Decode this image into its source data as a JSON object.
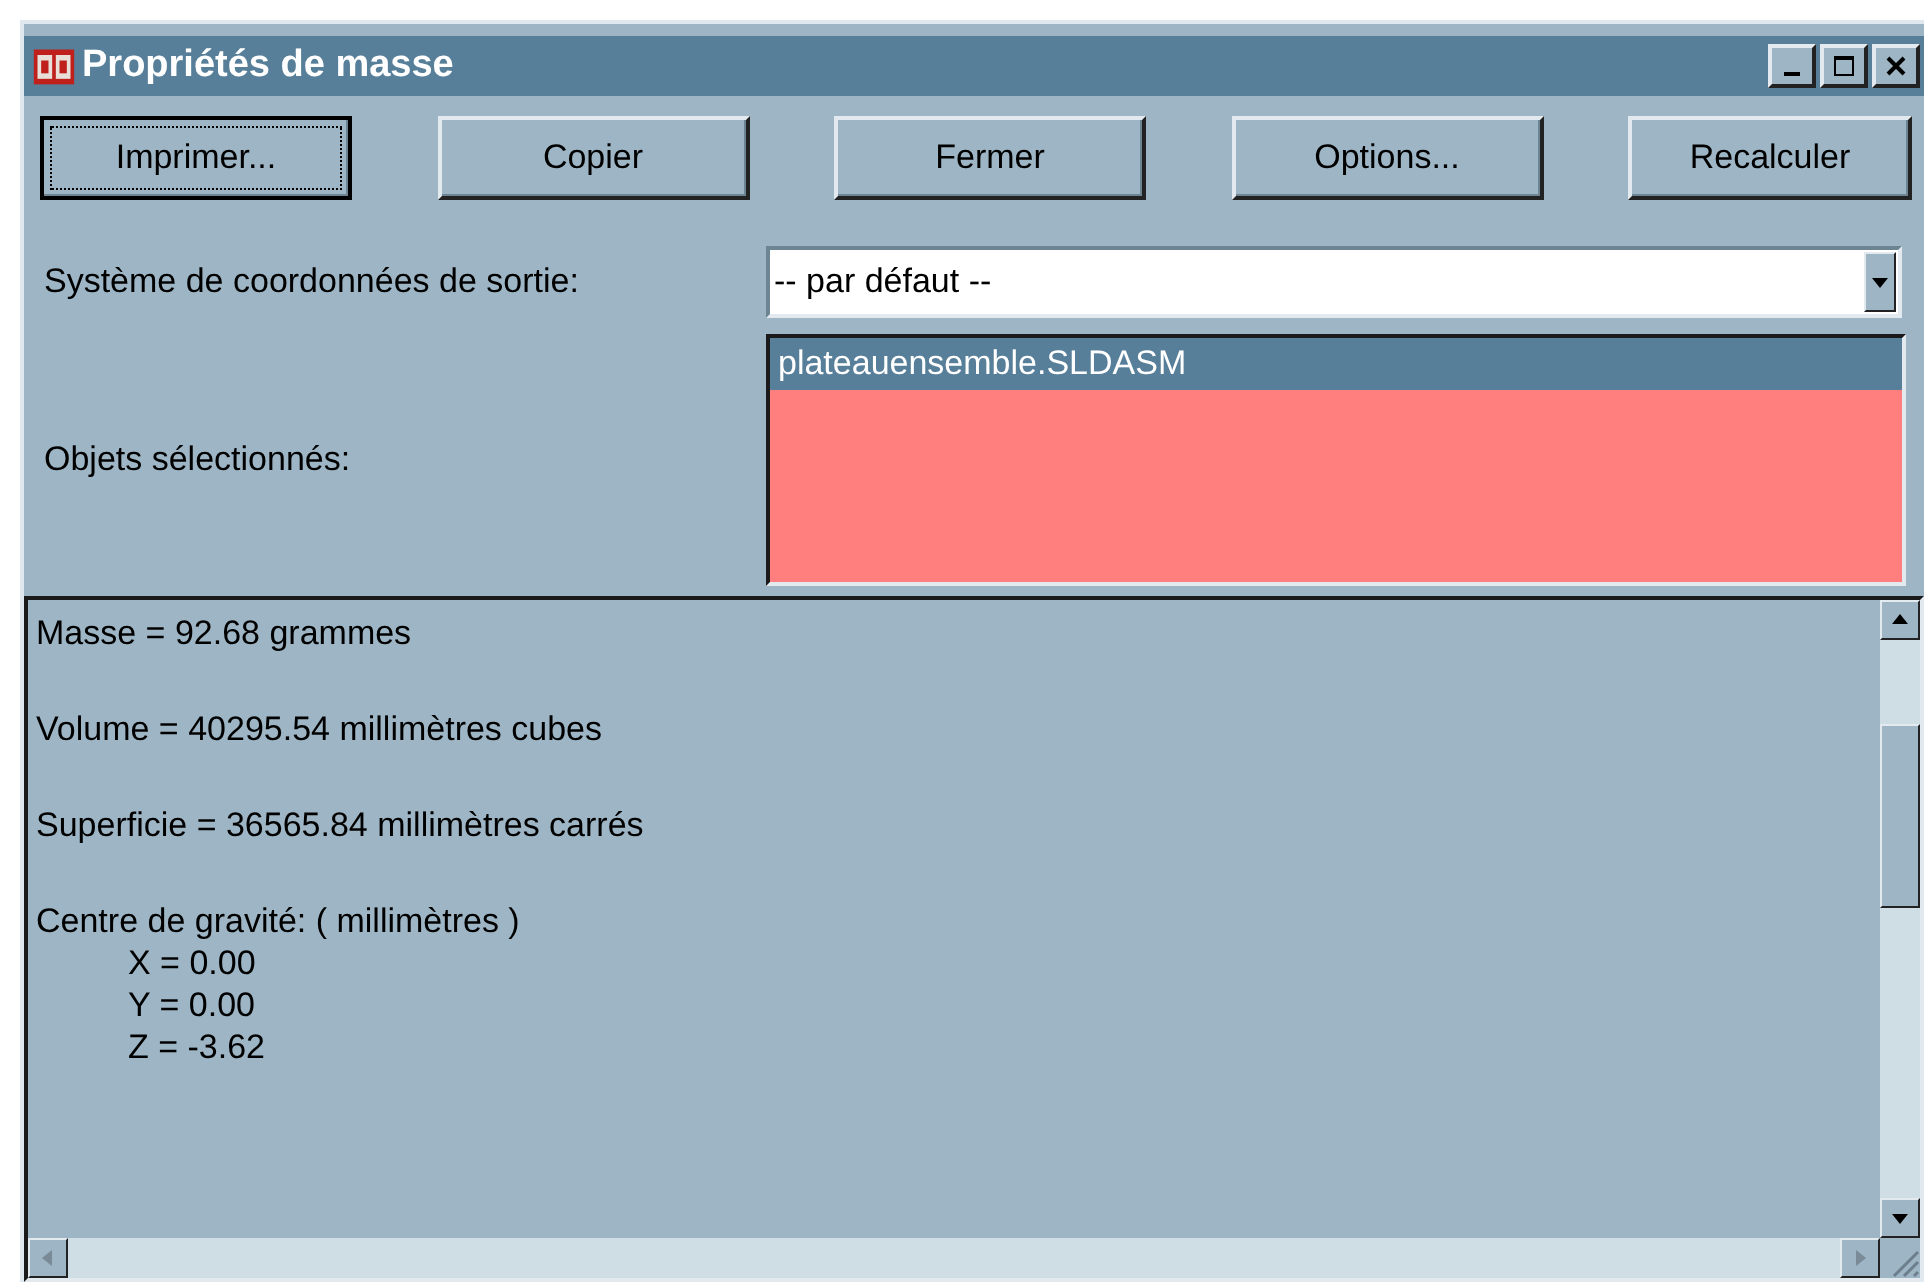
{
  "window": {
    "title": "Propriétés de masse"
  },
  "buttons": [
    {
      "label": "Imprimer...",
      "focused": true
    },
    {
      "label": "Copier",
      "focused": false
    },
    {
      "label": "Fermer",
      "focused": false
    },
    {
      "label": "Options...",
      "focused": false
    },
    {
      "label": "Recalculer",
      "focused": false
    }
  ],
  "coordinate_system": {
    "label": "Système de coordonnées de sortie:",
    "value": "-- par défaut --"
  },
  "selected_objects": {
    "label": "Objets sélectionnés:",
    "items": [
      {
        "text": "plateauensemble.SLDASM",
        "selected": true
      }
    ]
  },
  "results": [
    {
      "text": "Masse = 92.68 grammes"
    },
    {
      "text": "Volume = 40295.54 millimètres cubes"
    },
    {
      "text": "Superficie = 36565.84 millimètres carrés"
    },
    {
      "text": "Centre de gravité: ( millimètres )",
      "children": [
        {
          "text": "X = 0.00"
        },
        {
          "text": "Y = 0.00"
        },
        {
          "text": "Z = -3.62"
        }
      ]
    }
  ]
}
